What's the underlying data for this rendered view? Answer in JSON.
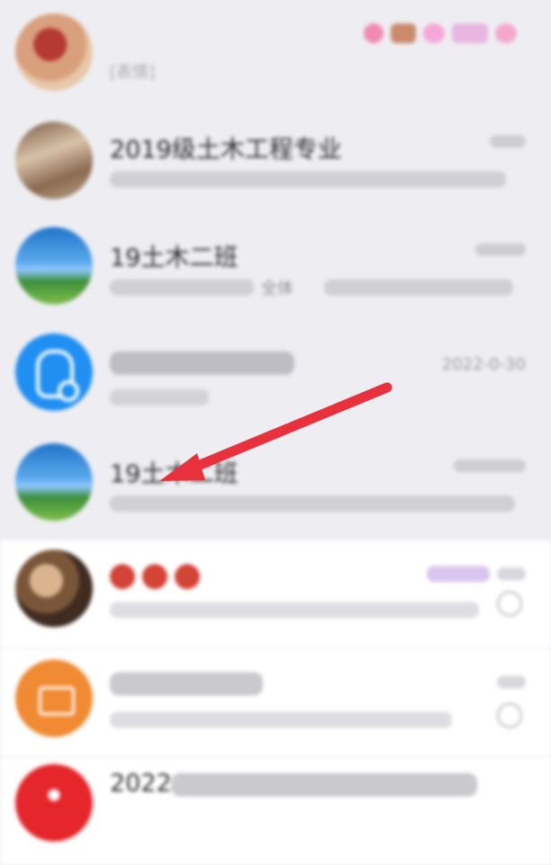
{
  "chats": [
    {
      "title": "",
      "subtitle": "[表情]",
      "time": "",
      "avatar_color": "#c98f7c"
    },
    {
      "title": "2019级土木工程专业",
      "subtitle": "",
      "time": "",
      "avatar_color": "#9b7a62"
    },
    {
      "title": "19土木二班",
      "subtitle": "全体",
      "time": "",
      "avatar_color": "#3c8ad6"
    },
    {
      "title": "",
      "subtitle": "",
      "time": "2022-0-30",
      "avatar_color": "#1f8ff2"
    },
    {
      "title": "19土木二班",
      "subtitle": "",
      "time": "",
      "avatar_color": "#3c8ad6"
    },
    {
      "title": "",
      "subtitle": "",
      "time": "",
      "avatar_color": "#8a6a4c"
    },
    {
      "title": "",
      "subtitle": "",
      "time": "",
      "avatar_color": "#f08a33"
    },
    {
      "title": "2022",
      "subtitle": "",
      "time": "",
      "avatar_color": "#e5262b"
    }
  ],
  "colors": {
    "arrow": "#e8313d",
    "page_bg": "#eeeef2",
    "row_light": "#ffffff"
  },
  "icons": {
    "qq_account": "qq-penguin-icon",
    "mute": "bell-mute-icon",
    "pointer": "red-arrow-icon"
  }
}
